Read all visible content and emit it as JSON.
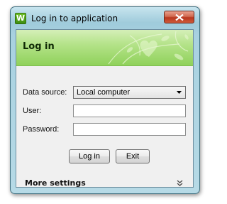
{
  "window": {
    "title": "Log in to application",
    "app_icon_glyph": "W",
    "icon_name": "app-w-icon",
    "close_icon": "close-icon"
  },
  "header": {
    "title": "Log in"
  },
  "form": {
    "data_source_label": "Data source:",
    "data_source_value": "Local computer",
    "user_label": "User:",
    "user_value": "",
    "password_label": "Password:",
    "password_value": ""
  },
  "buttons": {
    "login_label": "Log in",
    "exit_label": "Exit"
  },
  "more_settings": {
    "label": "More settings",
    "icon": "double-chevron-down-icon"
  },
  "colors": {
    "banner_green": "#9fd86a",
    "close_red": "#c74a30"
  }
}
